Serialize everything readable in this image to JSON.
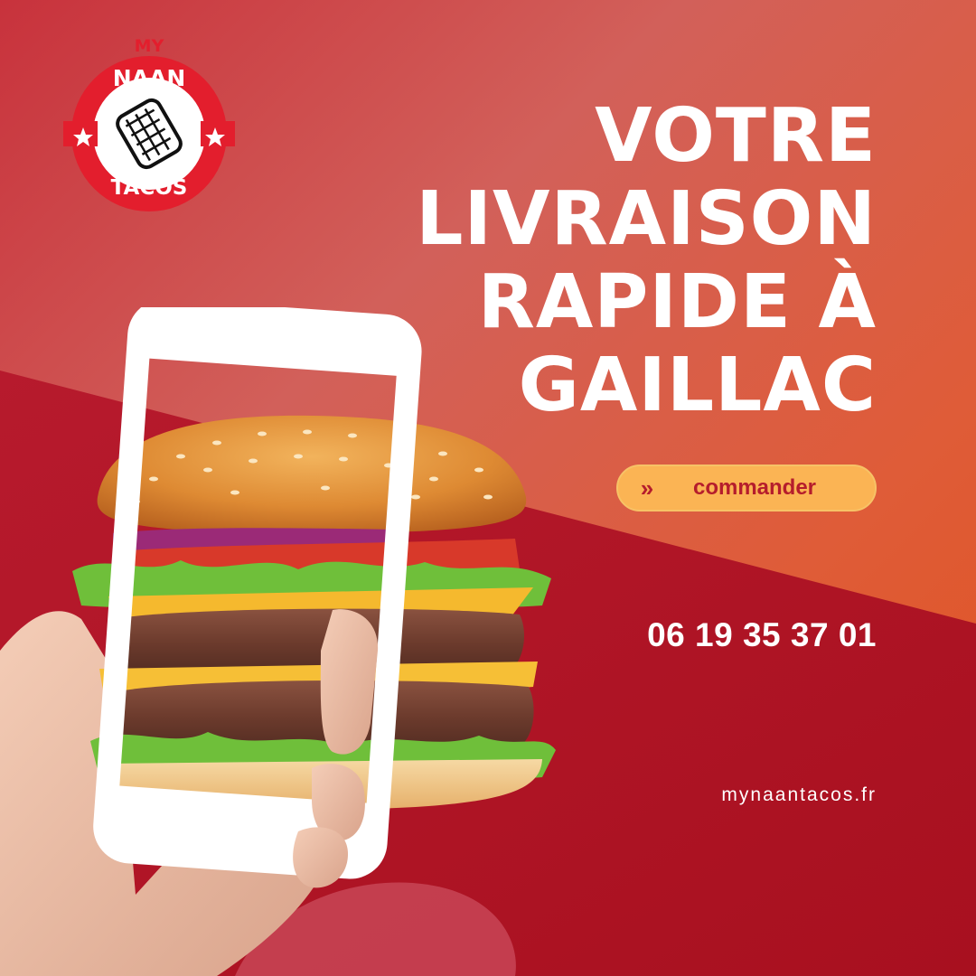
{
  "brand": {
    "logo_line_top": "MY",
    "logo_line_middle": "NAAN",
    "logo_line_bottom": "TACOS"
  },
  "headline": {
    "line1": "VOTRE",
    "line2": "LIVRAISON",
    "line3": "RAPIDE À",
    "line4": "GAILLAC"
  },
  "cta": {
    "label": "commander",
    "icon": "double-chevron-right-icon",
    "glyph": "»"
  },
  "contact": {
    "phone": "06 19 35 37 01",
    "website": "mynaantacos.fr"
  },
  "colors": {
    "background_red": "#b4192a",
    "background_orange": "#e45a3e",
    "button_fill": "#fbb454",
    "button_text": "#b51d2c",
    "logo_red": "#e31e2d"
  },
  "illustration": {
    "subject": "hand-holding-phone-over-burger-icon"
  }
}
